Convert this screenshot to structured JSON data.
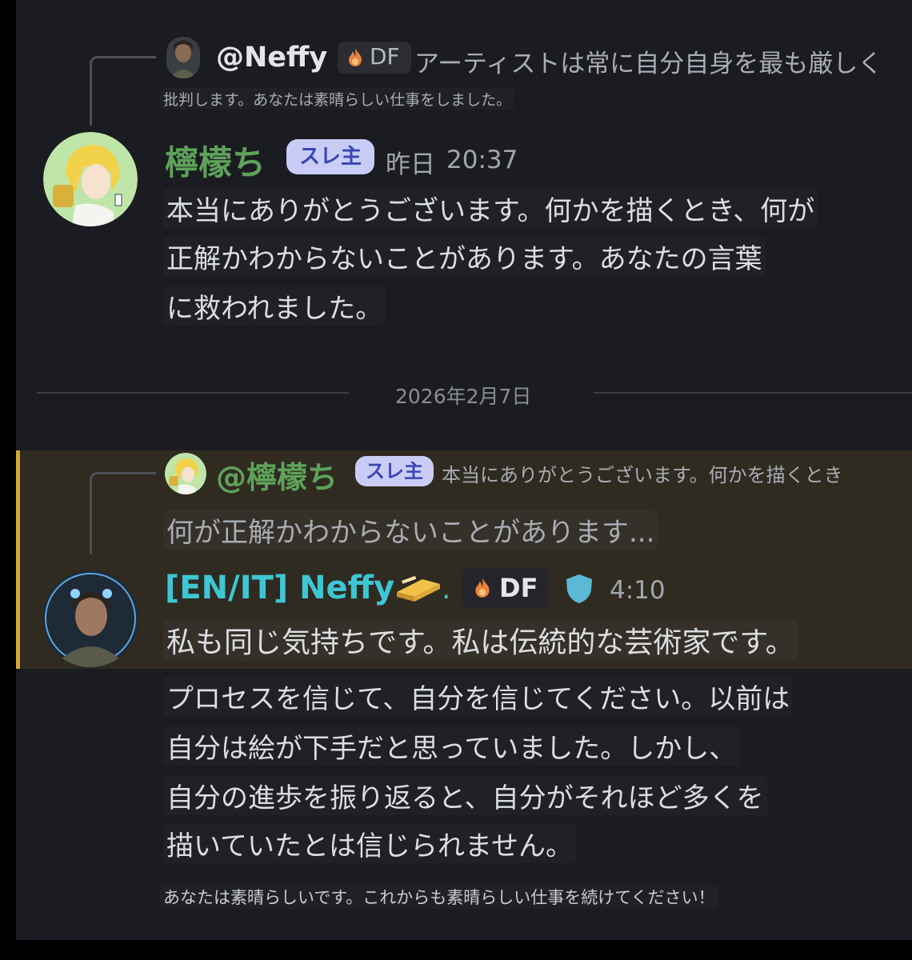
{
  "colors": {
    "background": "#1b1c21",
    "highlight": "#2f2b21",
    "highlight_bar": "#d4a63a",
    "username_green": "#5ea25a",
    "username_teal": "#3ec6d4",
    "op_chip_bg": "#c9cdf6",
    "op_chip_text": "#3b45b4"
  },
  "message1": {
    "reply": {
      "avatar_icon": "avatar-neffy-icon",
      "username": "@Neffy",
      "tag_icon": "flame-icon",
      "tag_label": "DF",
      "preview_line1": "アーティストは常に自分自身を最も厳しく",
      "preview_line2": "批判します。あなたは素晴らしい仕事をしました。"
    },
    "author": {
      "avatar_icon": "avatar-lemon-icon",
      "username": "檸檬ち",
      "badge": "スレ主",
      "day": "昨日",
      "time": "20:37"
    },
    "lines": [
      "本当にありがとうございます。何かを描くとき、何が",
      "正解かわからないことがあります。あなたの言葉",
      "に救われました。"
    ]
  },
  "date_divider": "2026年2月7日",
  "message2": {
    "reply": {
      "avatar_icon": "avatar-lemon-icon",
      "username": "@檸檬ち",
      "badge": "スレ主",
      "preview_line1": "本当にありがとうございます。何かを描くとき",
      "preview_line2": "何が正解かわからないことがあります..."
    },
    "author": {
      "avatar_icon": "avatar-neffy-icon",
      "username": "[EN/IT] Neffy",
      "emoji_icon": "butter-icon",
      "emoji_suffix": ".",
      "tag_icon": "flame-icon",
      "tag_label": "DF",
      "shield_icon": "shield-icon",
      "time": "4:10"
    },
    "lines": [
      "私も同じ気持ちです。私は伝統的な芸術家です。",
      "プロセスを信じて、自分を信じてください。以前は",
      "自分は絵が下手だと思っていました。しかし、",
      "自分の進歩を振り返ると、自分がそれほど多くを",
      "描いていたとは信じられません。"
    ],
    "footer": "あなたは素晴らしいです。これからも素晴らしい仕事を続けてください！"
  }
}
